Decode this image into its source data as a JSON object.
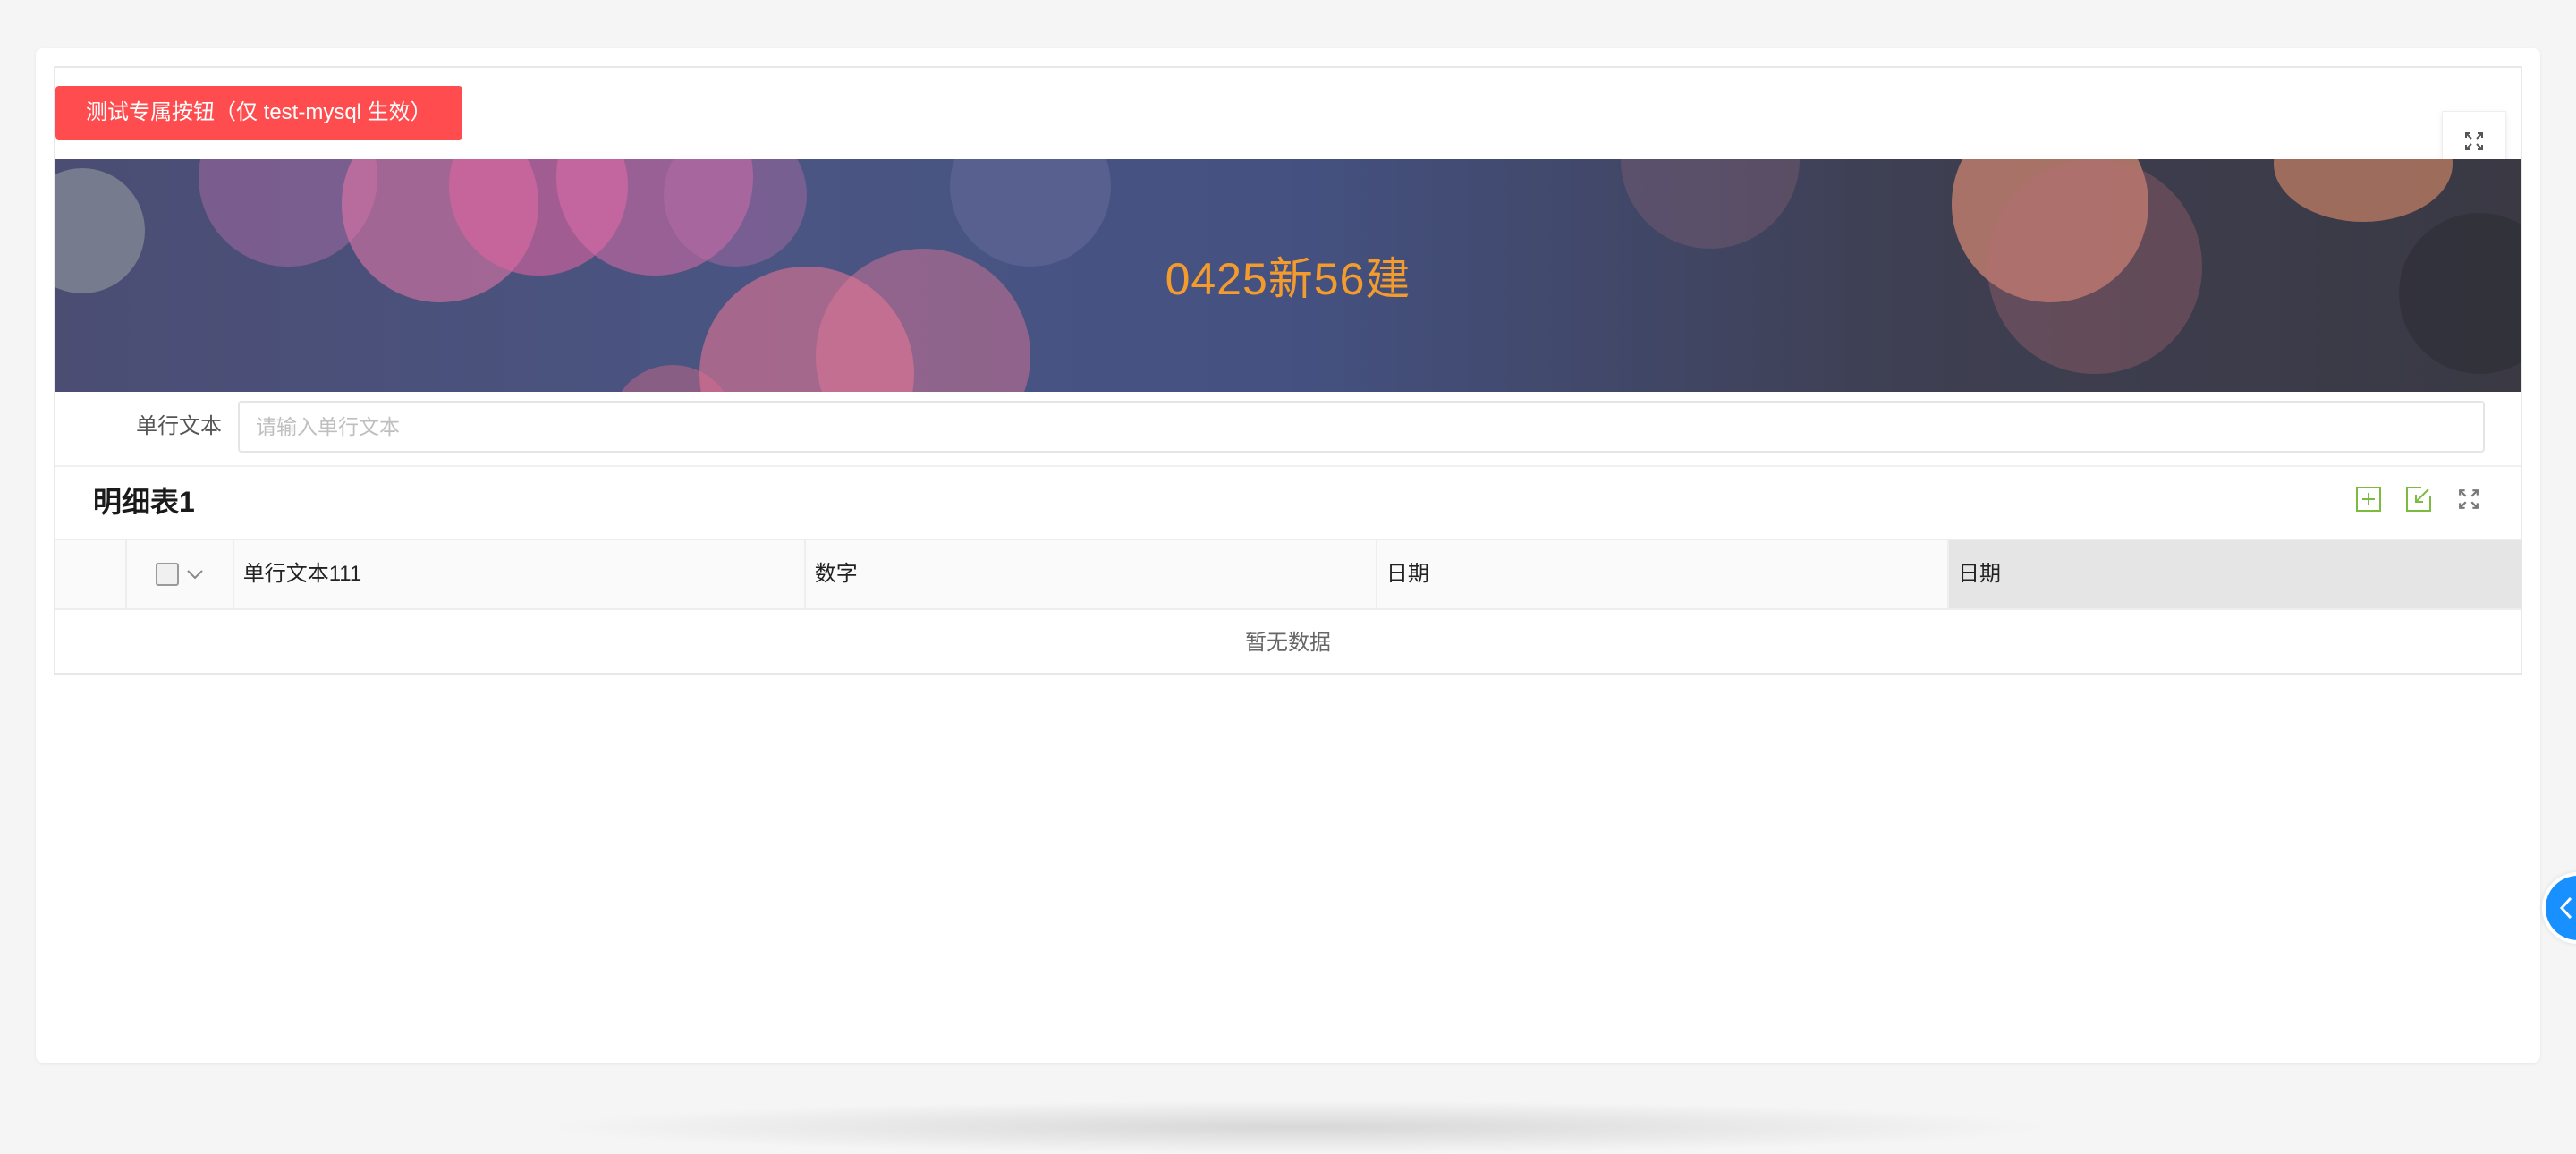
{
  "test_button": {
    "label": "测试专属按钮（仅 test-mysql 生效）"
  },
  "banner": {
    "title": "0425新56建"
  },
  "form": {
    "field_label": "单行文本",
    "field_placeholder": "请输入单行文本",
    "field_value": ""
  },
  "subtable": {
    "title": "明细表1",
    "columns": [
      "单行文本111",
      "数字",
      "日期",
      "日期"
    ],
    "empty_text": "暂无数据"
  },
  "icons": {
    "fullscreen": "fullscreen-icon",
    "add_row": "add-row-icon",
    "import": "import-icon",
    "expand": "expand-icon",
    "side_toggle": "chevron-left-icon",
    "checkbox_dropdown": "chevron-down-icon"
  },
  "colors": {
    "danger": "#ff4d4f",
    "banner_title": "#f39b2c",
    "tool_green": "#7cbb3f",
    "primary_blue": "#1890ff"
  }
}
